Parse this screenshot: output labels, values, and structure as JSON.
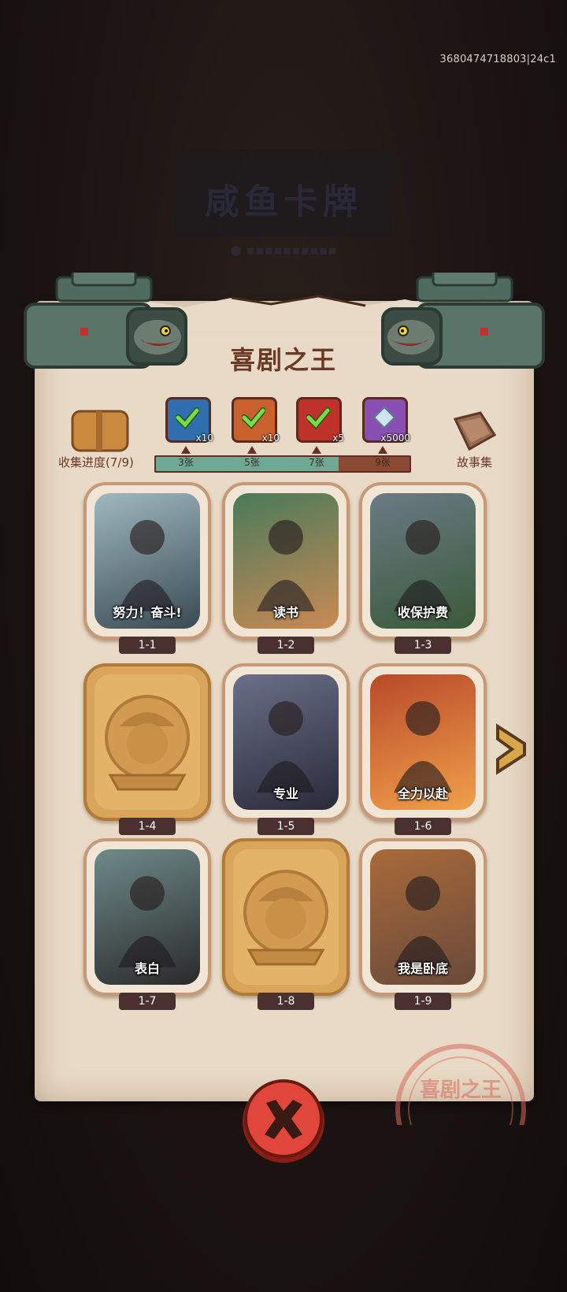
{
  "debug_id": "3680474718803|24c1",
  "background": {
    "title": "咸鱼卡牌"
  },
  "panel": {
    "title": "喜剧之王"
  },
  "progress": {
    "label": "收集进度(7/9)",
    "collected": 7,
    "total": 9,
    "milestones": [
      {
        "label": "3张",
        "reward_count": "x10",
        "reward": "chest-icon",
        "claimed": true,
        "color": "#2f6fb0"
      },
      {
        "label": "5张",
        "reward_count": "x10",
        "reward": "key-icon",
        "claimed": true,
        "color": "#c8612e"
      },
      {
        "label": "7张",
        "reward_count": "x5",
        "reward": "orb-icon",
        "claimed": true,
        "color": "#c0312c"
      },
      {
        "label": "9张",
        "reward_count": "x5000",
        "reward": "diamond-icon",
        "claimed": false,
        "color": "#8a4fb3"
      }
    ]
  },
  "story": {
    "label": "故事集"
  },
  "cards": [
    {
      "num": "1-1",
      "name": "努力！奋斗!",
      "locked": false,
      "scene": "wave"
    },
    {
      "num": "1-2",
      "name": "读书",
      "locked": false,
      "scene": "reading"
    },
    {
      "num": "1-3",
      "name": "收保护费",
      "locked": false,
      "scene": "gangster"
    },
    {
      "num": "1-4",
      "name": "",
      "locked": true,
      "scene": "locked"
    },
    {
      "num": "1-5",
      "name": "专业",
      "locked": false,
      "scene": "fight"
    },
    {
      "num": "1-6",
      "name": "全力以赴",
      "locked": false,
      "scene": "fire"
    },
    {
      "num": "1-7",
      "name": "表白",
      "locked": false,
      "scene": "confess"
    },
    {
      "num": "1-8",
      "name": "",
      "locked": true,
      "scene": "locked"
    },
    {
      "num": "1-9",
      "name": "我是卧底",
      "locked": false,
      "scene": "undercover"
    }
  ],
  "stamp_text": "喜剧之王",
  "colors": {
    "paper": "#e8dac6",
    "title": "#6b3a26",
    "bar_fill": "#6fa995",
    "bar_empty": "#8a4a34",
    "close": "#e0463a"
  }
}
